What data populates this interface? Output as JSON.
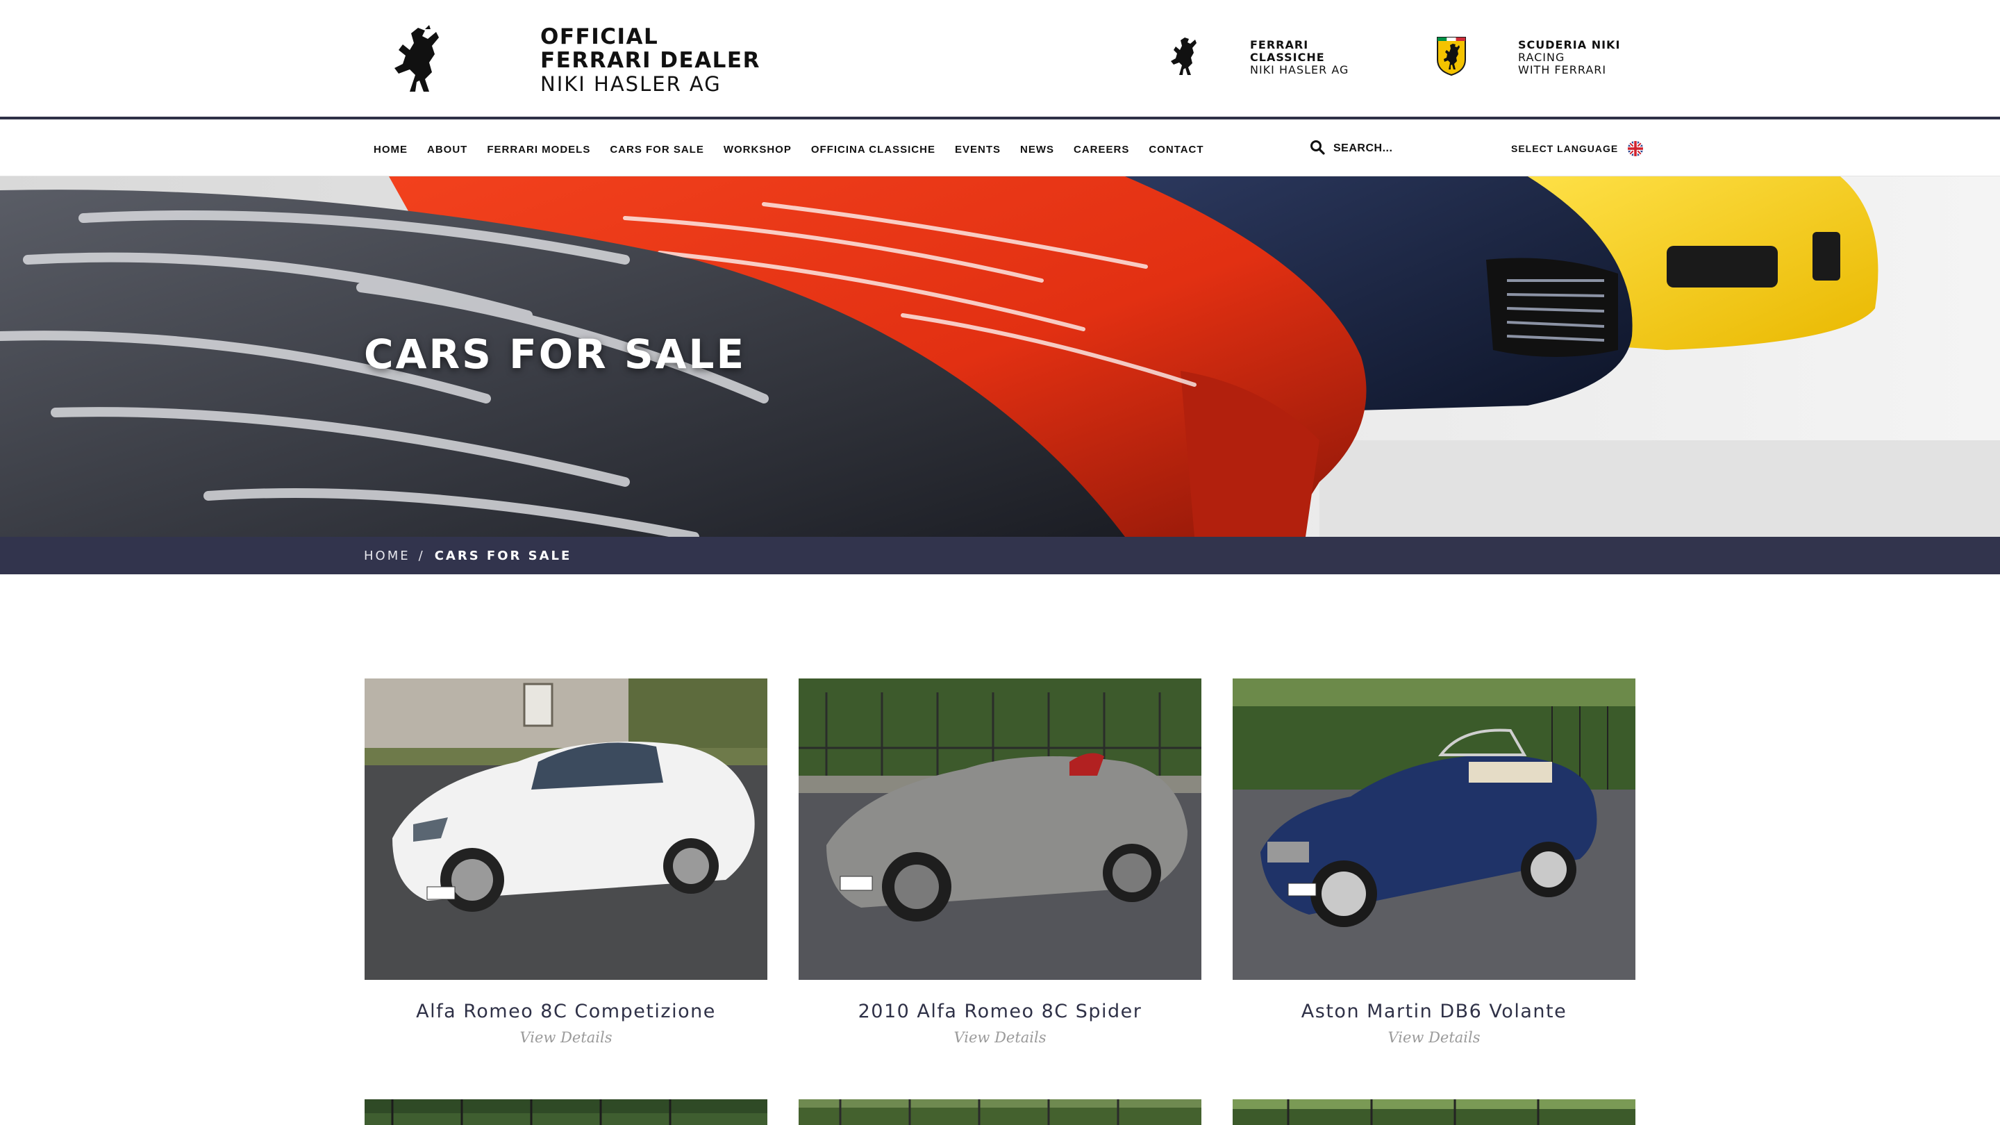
{
  "header": {
    "logo_icon": "prancing-horse-icon",
    "title_line1": "OFFICIAL",
    "title_line2": "FERRARI DEALER",
    "title_line3": "NIKI HASLER AG",
    "partners": [
      {
        "icon": "prancing-horse-icon",
        "bold": "FERRARI",
        "line2": "CLASSICHE",
        "line3": "NIKI HASLER AG"
      },
      {
        "icon": "ferrari-shield-icon",
        "bold": "SCUDERIA NIKI",
        "line2": "RACING",
        "line3": "WITH FERRARI"
      }
    ]
  },
  "nav": {
    "items": [
      "HOME",
      "ABOUT",
      "FERRARI MODELS",
      "CARS FOR SALE",
      "WORKSHOP",
      "OFFICINA CLASSICHE",
      "EVENTS",
      "NEWS",
      "CAREERS",
      "CONTACT"
    ],
    "search_placeholder": "SEARCH...",
    "language_label": "SELECT LANGUAGE",
    "language_icon": "uk-flag-icon"
  },
  "hero": {
    "title": "CARS FOR SALE"
  },
  "breadcrumb": {
    "home": "HOME",
    "separator": "/",
    "current": "CARS FOR SALE"
  },
  "listings": [
    {
      "title": "Alfa Romeo 8C Competizione",
      "link": "View Details",
      "car_color": "#f2f2f2"
    },
    {
      "title": "2010 Alfa Romeo 8C Spider",
      "link": "View Details",
      "car_color": "#8d8d8b"
    },
    {
      "title": "Aston Martin DB6 Volante",
      "link": "View Details",
      "car_color": "#1f3368"
    }
  ],
  "colors": {
    "nav_border": "#2f3147",
    "breadcrumb_bg": "#32344d",
    "card_title": "#2f3147",
    "card_link": "#9a9a9a"
  }
}
